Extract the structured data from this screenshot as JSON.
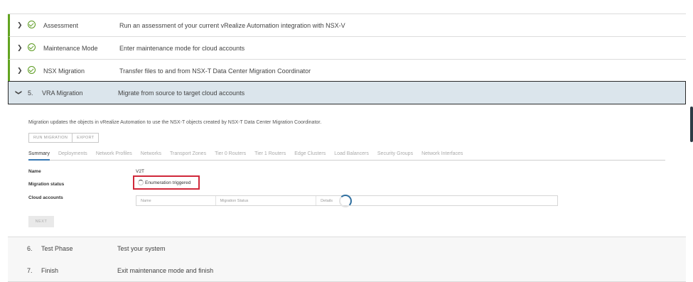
{
  "steps": [
    {
      "number": "",
      "title": "Assessment",
      "description": "Run an assessment of your current vRealize Automation integration with NSX-V",
      "status": "complete"
    },
    {
      "number": "",
      "title": "Maintenance Mode",
      "description": "Enter maintenance mode for cloud accounts",
      "status": "complete"
    },
    {
      "number": "",
      "title": "NSX Migration",
      "description": "Transfer files to and from NSX-T Data Center Migration Coordinator",
      "status": "complete"
    },
    {
      "number": "5.",
      "title": "VRA Migration",
      "description": "Migrate from source to target cloud accounts",
      "status": "active"
    },
    {
      "number": "6.",
      "title": "Test Phase",
      "description": "Test your system",
      "status": "pending"
    },
    {
      "number": "7.",
      "title": "Finish",
      "description": "Exit maintenance mode and finish",
      "status": "pending"
    }
  ],
  "panel": {
    "intro": "Migration updates the objects in vRealize Automation to use the NSX-T objects created by NSX-T Data Center Migration Coordinator.",
    "buttons": {
      "run": "RUN MIGRATION",
      "export": "EXPORT"
    },
    "tabs": [
      "Summary",
      "Deployments",
      "Network Profiles",
      "Networks",
      "Transport Zones",
      "Tier 0 Routers",
      "Tier 1 Routers",
      "Edge Clusters",
      "Load Balancers",
      "Security Groups",
      "Network Interfaces"
    ],
    "active_tab": "Summary",
    "fields": {
      "name_label": "Name",
      "name_value": "V2T",
      "status_label": "Migration status",
      "status_value": "Enumeration triggered",
      "cloud_label": "Cloud accounts"
    },
    "table_columns": [
      "Name",
      "Migration Status",
      "Details"
    ],
    "next_label": "NEXT"
  },
  "colors": {
    "complete": "#62a420",
    "active_bg": "#dbe5ec",
    "highlight": "#d0283a",
    "tab_accent": "#3779b5"
  },
  "icons": {
    "expanded": "chevron-down-icon",
    "collapsed": "chevron-right-icon",
    "complete": "check-circle-icon"
  }
}
